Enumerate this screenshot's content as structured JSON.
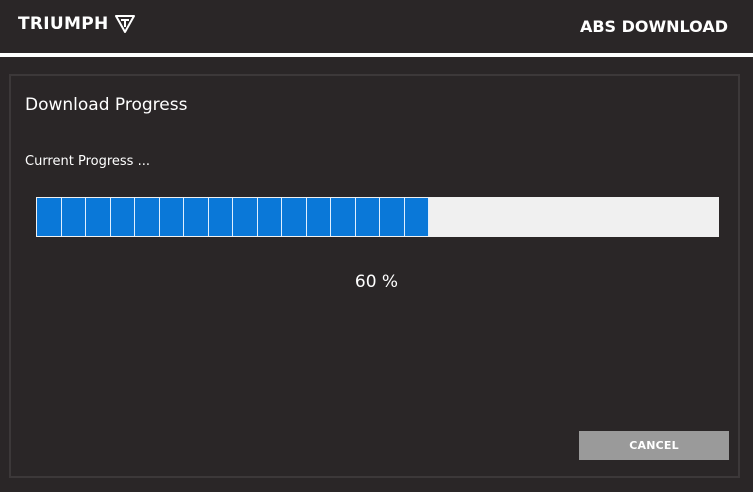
{
  "header": {
    "brand": "TRIUMPH",
    "logo_icon": "triumph-triangle-logo",
    "title": "ABS DOWNLOAD"
  },
  "panel": {
    "title": "Download Progress",
    "status_label": "Current Progress ...",
    "progress": {
      "percent_value": 60,
      "percent_text": "60 %",
      "total_segments": 27,
      "filled_segments": 16
    },
    "cancel_label": "CANCEL"
  },
  "colors": {
    "background": "#2a2627",
    "progress_fill": "#0a78d8",
    "progress_track": "#f0f0f0",
    "button": "#9a9a9a",
    "text": "#ffffff"
  }
}
